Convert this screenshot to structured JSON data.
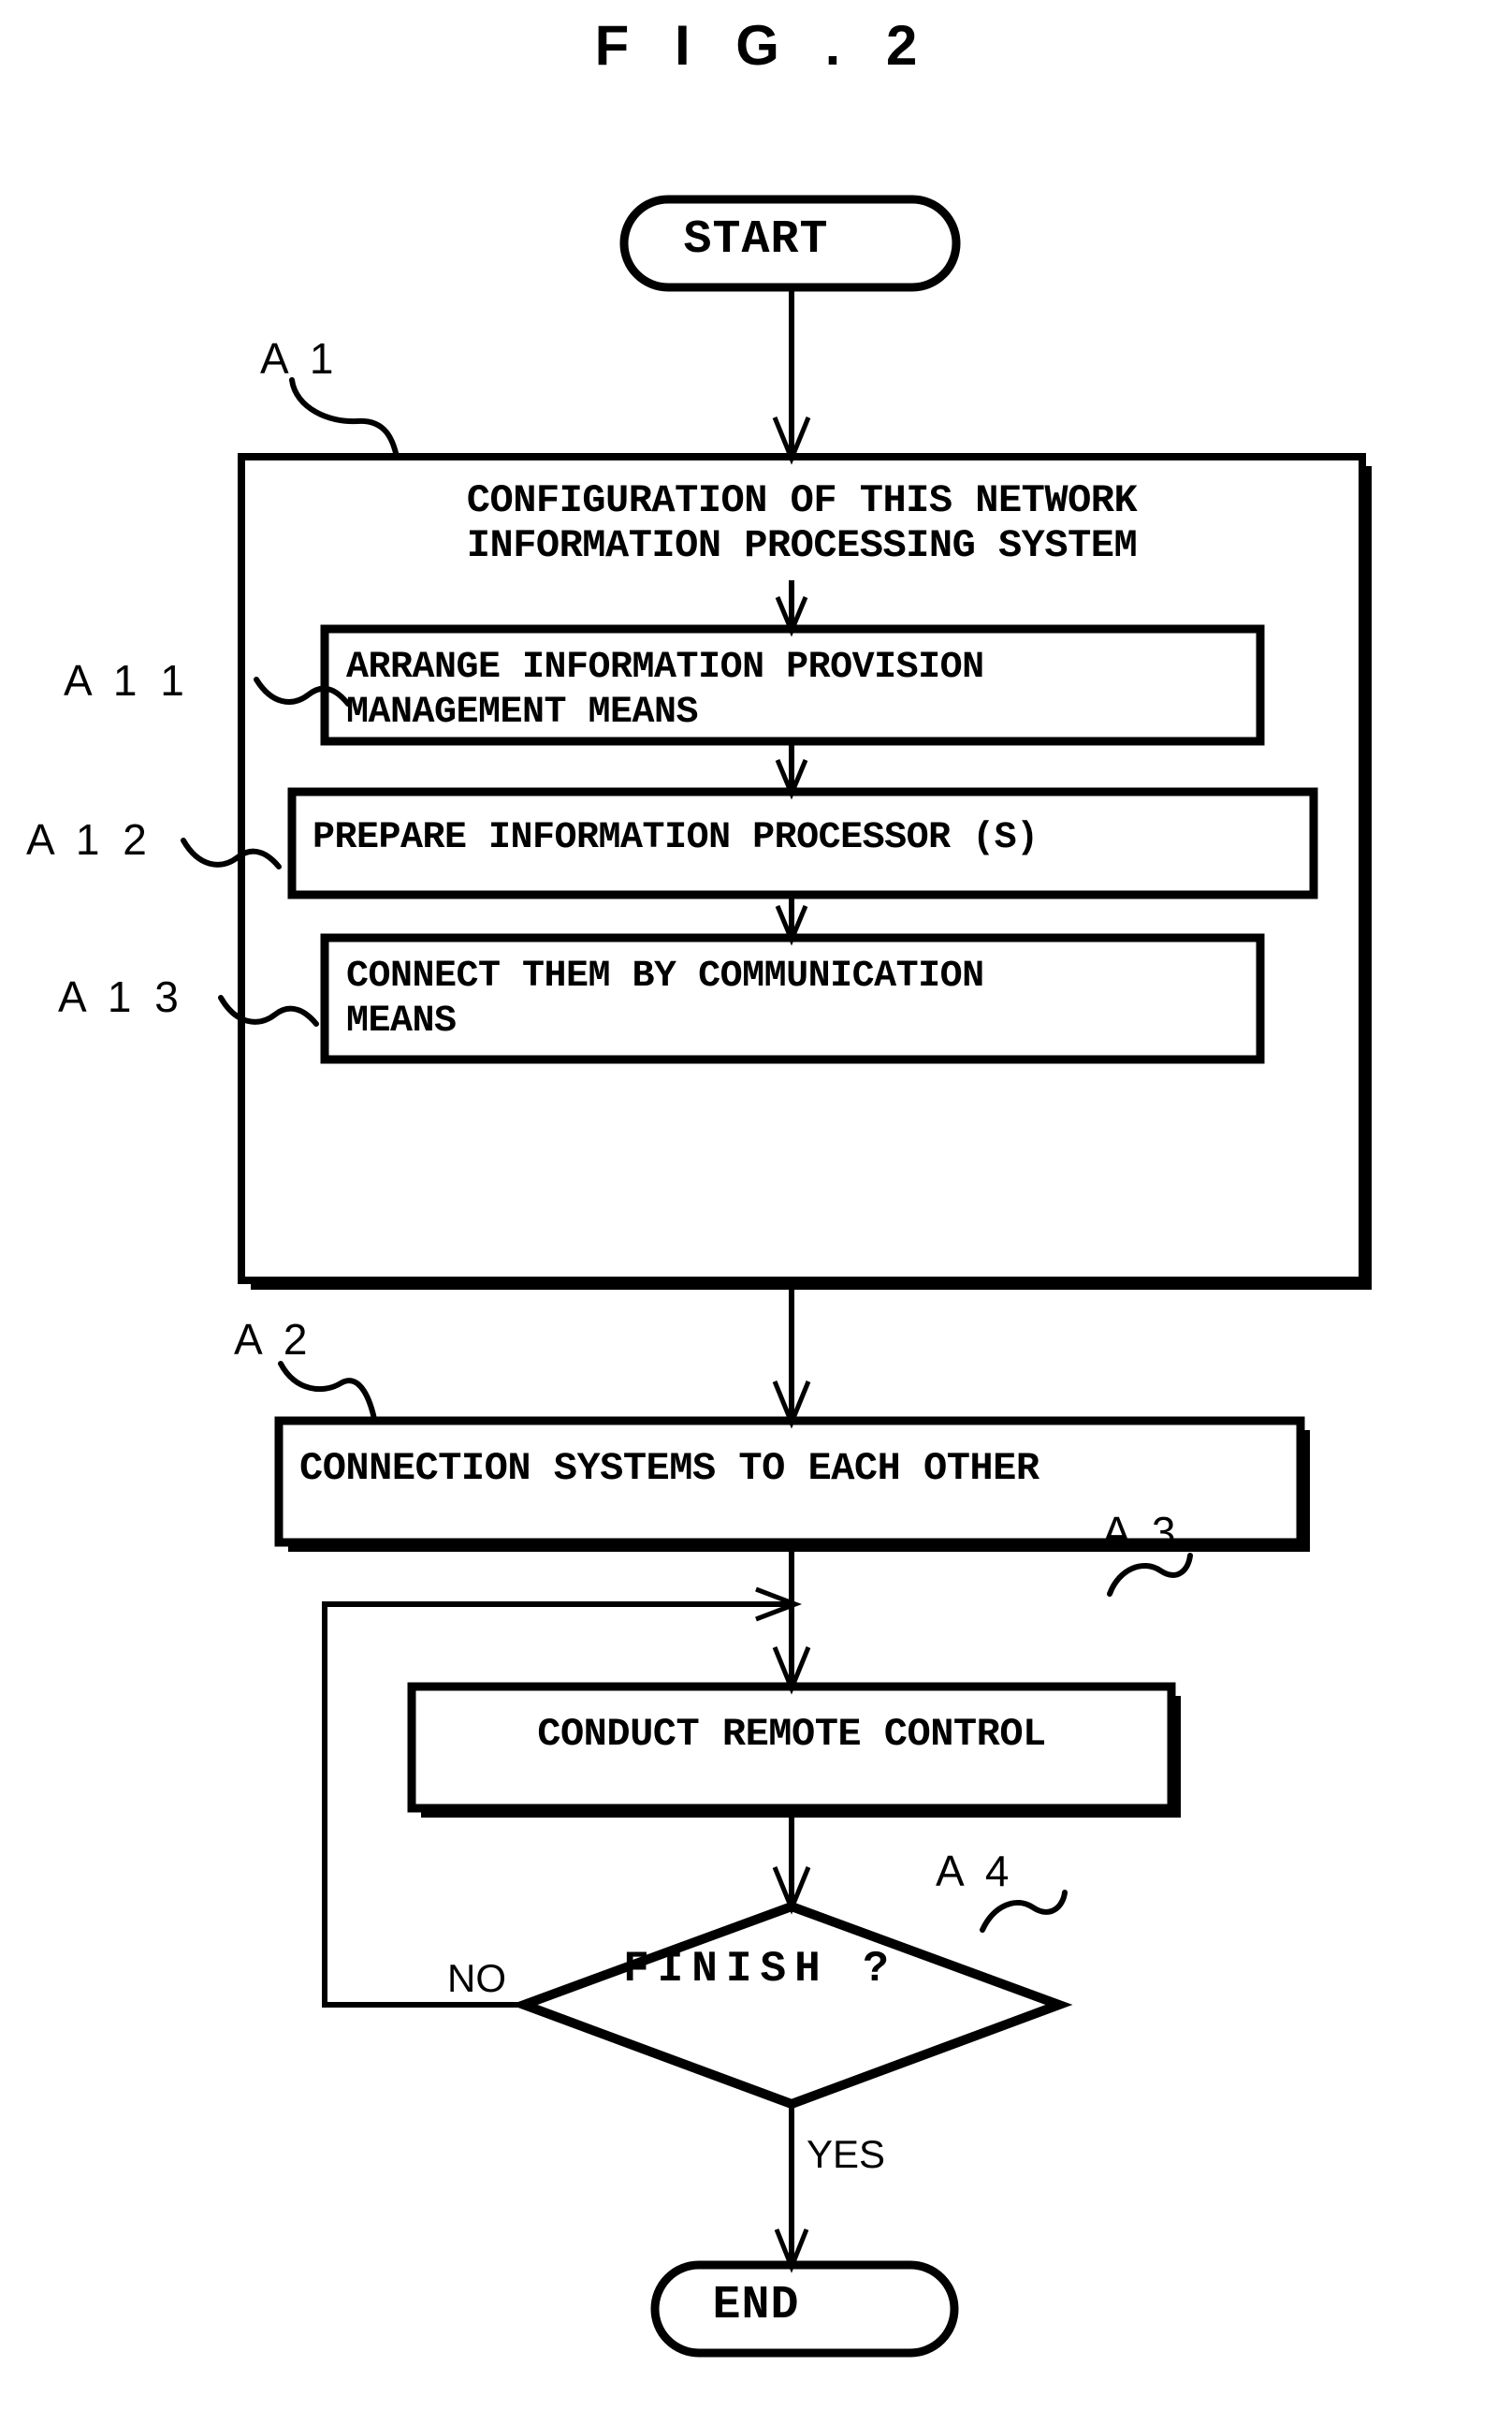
{
  "figure": {
    "title": "F I G .  2"
  },
  "flowchart": {
    "type": "flowchart",
    "orientation": "top-to-bottom",
    "terminals": {
      "start": "START",
      "end": "END"
    },
    "reference_labels": {
      "a1": "A 1",
      "a11": "A 1 1",
      "a12": "A 1 2",
      "a13": "A 1 3",
      "a2": "A 2",
      "a3": "A 3",
      "a4": "A 4"
    },
    "group_a1": {
      "ref": "A 1",
      "heading_line1": "CONFIGURATION OF THIS NETWORK",
      "heading_line2": "INFORMATION PROCESSING SYSTEM",
      "steps": [
        {
          "ref": "A 1 1",
          "line1": "ARRANGE  INFORMATION PROVISION",
          "line2": "MANAGEMENT MEANS"
        },
        {
          "ref": "A 1 2",
          "line1": "PREPARE  INFORMATION PROCESSOR (S)",
          "line2": ""
        },
        {
          "ref": "A 1 3",
          "line1": "CONNECT THEM BY COMMUNICATION",
          "line2": "MEANS"
        }
      ]
    },
    "step_a2": {
      "ref": "A 2",
      "label": "CONNECTION SYSTEMS TO EACH OTHER"
    },
    "step_a3": {
      "ref": "A 3",
      "label": "CONDUCT REMOTE CONTROL"
    },
    "decision_a4": {
      "ref": "A 4",
      "label": "FINISH ?",
      "branch_no": "NO",
      "branch_yes": "YES"
    },
    "colors": {
      "stroke": "#000000",
      "fill": "#ffffff",
      "background": "#ffffff"
    }
  }
}
